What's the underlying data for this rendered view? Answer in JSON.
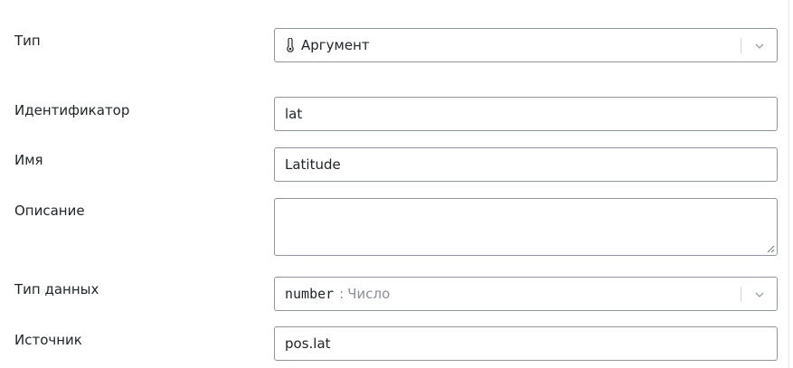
{
  "form": {
    "type": {
      "label": "Тип",
      "value": "Аргумент",
      "icon": "thermometer-icon"
    },
    "identifier": {
      "label": "Идентификатор",
      "value": "lat"
    },
    "name": {
      "label": "Имя",
      "value": "Latitude"
    },
    "description": {
      "label": "Описание",
      "value": ""
    },
    "data_type": {
      "label": "Тип данных",
      "code": "number",
      "separator": ":",
      "hint": "Число"
    },
    "source": {
      "label": "Источник",
      "value": "pos.lat"
    }
  },
  "colors": {
    "border": "#8f959c",
    "text": "#212529",
    "muted": "#8a9096"
  }
}
